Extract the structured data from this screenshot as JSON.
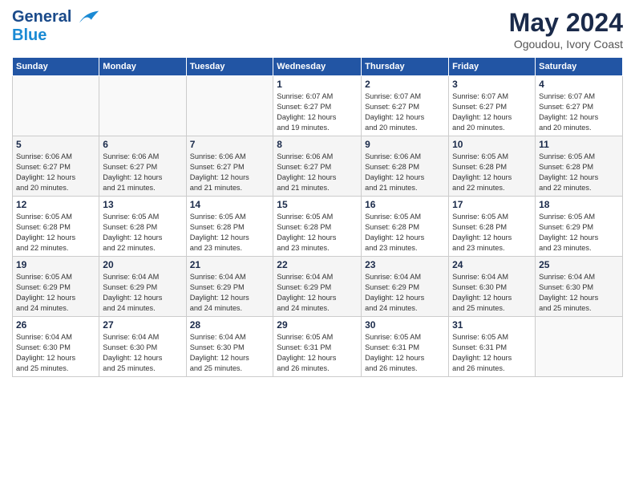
{
  "header": {
    "logo_line1": "General",
    "logo_line2": "Blue",
    "month_year": "May 2024",
    "location": "Ogoudou, Ivory Coast"
  },
  "weekdays": [
    "Sunday",
    "Monday",
    "Tuesday",
    "Wednesday",
    "Thursday",
    "Friday",
    "Saturday"
  ],
  "weeks": [
    [
      {
        "day": "",
        "info": ""
      },
      {
        "day": "",
        "info": ""
      },
      {
        "day": "",
        "info": ""
      },
      {
        "day": "1",
        "info": "Sunrise: 6:07 AM\nSunset: 6:27 PM\nDaylight: 12 hours\nand 19 minutes."
      },
      {
        "day": "2",
        "info": "Sunrise: 6:07 AM\nSunset: 6:27 PM\nDaylight: 12 hours\nand 20 minutes."
      },
      {
        "day": "3",
        "info": "Sunrise: 6:07 AM\nSunset: 6:27 PM\nDaylight: 12 hours\nand 20 minutes."
      },
      {
        "day": "4",
        "info": "Sunrise: 6:07 AM\nSunset: 6:27 PM\nDaylight: 12 hours\nand 20 minutes."
      }
    ],
    [
      {
        "day": "5",
        "info": "Sunrise: 6:06 AM\nSunset: 6:27 PM\nDaylight: 12 hours\nand 20 minutes."
      },
      {
        "day": "6",
        "info": "Sunrise: 6:06 AM\nSunset: 6:27 PM\nDaylight: 12 hours\nand 21 minutes."
      },
      {
        "day": "7",
        "info": "Sunrise: 6:06 AM\nSunset: 6:27 PM\nDaylight: 12 hours\nand 21 minutes."
      },
      {
        "day": "8",
        "info": "Sunrise: 6:06 AM\nSunset: 6:27 PM\nDaylight: 12 hours\nand 21 minutes."
      },
      {
        "day": "9",
        "info": "Sunrise: 6:06 AM\nSunset: 6:28 PM\nDaylight: 12 hours\nand 21 minutes."
      },
      {
        "day": "10",
        "info": "Sunrise: 6:05 AM\nSunset: 6:28 PM\nDaylight: 12 hours\nand 22 minutes."
      },
      {
        "day": "11",
        "info": "Sunrise: 6:05 AM\nSunset: 6:28 PM\nDaylight: 12 hours\nand 22 minutes."
      }
    ],
    [
      {
        "day": "12",
        "info": "Sunrise: 6:05 AM\nSunset: 6:28 PM\nDaylight: 12 hours\nand 22 minutes."
      },
      {
        "day": "13",
        "info": "Sunrise: 6:05 AM\nSunset: 6:28 PM\nDaylight: 12 hours\nand 22 minutes."
      },
      {
        "day": "14",
        "info": "Sunrise: 6:05 AM\nSunset: 6:28 PM\nDaylight: 12 hours\nand 23 minutes."
      },
      {
        "day": "15",
        "info": "Sunrise: 6:05 AM\nSunset: 6:28 PM\nDaylight: 12 hours\nand 23 minutes."
      },
      {
        "day": "16",
        "info": "Sunrise: 6:05 AM\nSunset: 6:28 PM\nDaylight: 12 hours\nand 23 minutes."
      },
      {
        "day": "17",
        "info": "Sunrise: 6:05 AM\nSunset: 6:28 PM\nDaylight: 12 hours\nand 23 minutes."
      },
      {
        "day": "18",
        "info": "Sunrise: 6:05 AM\nSunset: 6:29 PM\nDaylight: 12 hours\nand 23 minutes."
      }
    ],
    [
      {
        "day": "19",
        "info": "Sunrise: 6:05 AM\nSunset: 6:29 PM\nDaylight: 12 hours\nand 24 minutes."
      },
      {
        "day": "20",
        "info": "Sunrise: 6:04 AM\nSunset: 6:29 PM\nDaylight: 12 hours\nand 24 minutes."
      },
      {
        "day": "21",
        "info": "Sunrise: 6:04 AM\nSunset: 6:29 PM\nDaylight: 12 hours\nand 24 minutes."
      },
      {
        "day": "22",
        "info": "Sunrise: 6:04 AM\nSunset: 6:29 PM\nDaylight: 12 hours\nand 24 minutes."
      },
      {
        "day": "23",
        "info": "Sunrise: 6:04 AM\nSunset: 6:29 PM\nDaylight: 12 hours\nand 24 minutes."
      },
      {
        "day": "24",
        "info": "Sunrise: 6:04 AM\nSunset: 6:30 PM\nDaylight: 12 hours\nand 25 minutes."
      },
      {
        "day": "25",
        "info": "Sunrise: 6:04 AM\nSunset: 6:30 PM\nDaylight: 12 hours\nand 25 minutes."
      }
    ],
    [
      {
        "day": "26",
        "info": "Sunrise: 6:04 AM\nSunset: 6:30 PM\nDaylight: 12 hours\nand 25 minutes."
      },
      {
        "day": "27",
        "info": "Sunrise: 6:04 AM\nSunset: 6:30 PM\nDaylight: 12 hours\nand 25 minutes."
      },
      {
        "day": "28",
        "info": "Sunrise: 6:04 AM\nSunset: 6:30 PM\nDaylight: 12 hours\nand 25 minutes."
      },
      {
        "day": "29",
        "info": "Sunrise: 6:05 AM\nSunset: 6:31 PM\nDaylight: 12 hours\nand 26 minutes."
      },
      {
        "day": "30",
        "info": "Sunrise: 6:05 AM\nSunset: 6:31 PM\nDaylight: 12 hours\nand 26 minutes."
      },
      {
        "day": "31",
        "info": "Sunrise: 6:05 AM\nSunset: 6:31 PM\nDaylight: 12 hours\nand 26 minutes."
      },
      {
        "day": "",
        "info": ""
      }
    ]
  ]
}
